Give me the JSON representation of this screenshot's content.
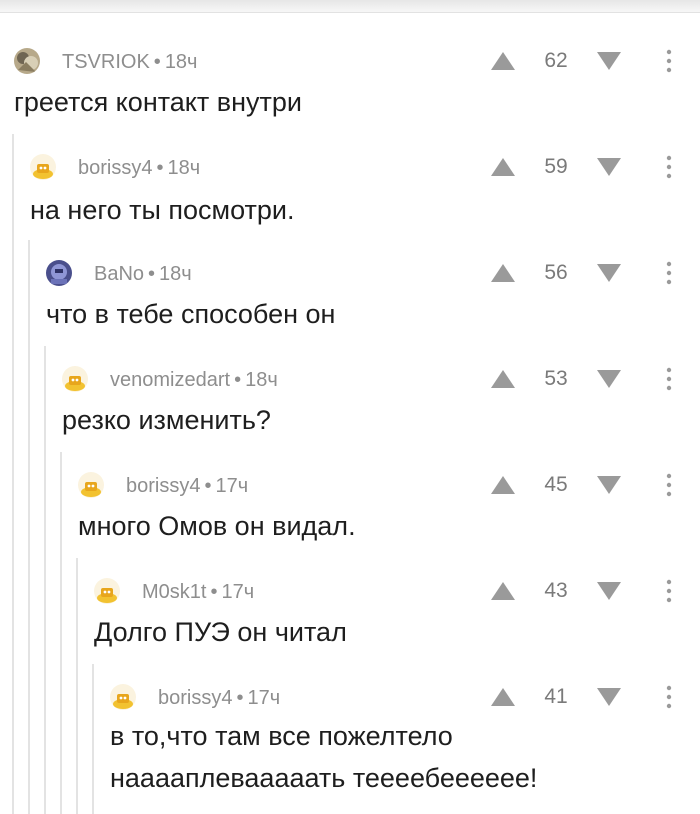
{
  "comments": [
    {
      "author": "TSVRIOK",
      "time": "18ч",
      "score": "62",
      "text": "греется контакт внутри",
      "avatar": "photo-avatar"
    },
    {
      "author": "borissy4",
      "time": "18ч",
      "score": "59",
      "text": "на него ты посмотри.",
      "avatar": "default-avatar"
    },
    {
      "author": "BaNo",
      "time": "18ч",
      "score": "56",
      "text": "что в тебе способен он",
      "avatar": "robot-avatar"
    },
    {
      "author": "venomizedart",
      "time": "18ч",
      "score": "53",
      "text": "резко изменить?",
      "avatar": "default-avatar"
    },
    {
      "author": "borissy4",
      "time": "17ч",
      "score": "45",
      "text": "много Омов он видал.",
      "avatar": "default-avatar"
    },
    {
      "author": "M0sk1t",
      "time": "17ч",
      "score": "43",
      "text": "Долго ПУЭ он читал",
      "avatar": "default-avatar"
    },
    {
      "author": "borissy4",
      "time": "17ч",
      "score": "41",
      "text": "в то,что там все пожелтело",
      "text2": "нааааплевааааать теееебееееее!",
      "avatar": "default-avatar"
    }
  ],
  "separator": "•",
  "colors": {
    "meta": "#8e8e8e",
    "text": "#1e1e1e",
    "icon": "#9a9a9a",
    "thread_line": "#e3e3e3",
    "avatar_yellow": "#f2c230"
  }
}
